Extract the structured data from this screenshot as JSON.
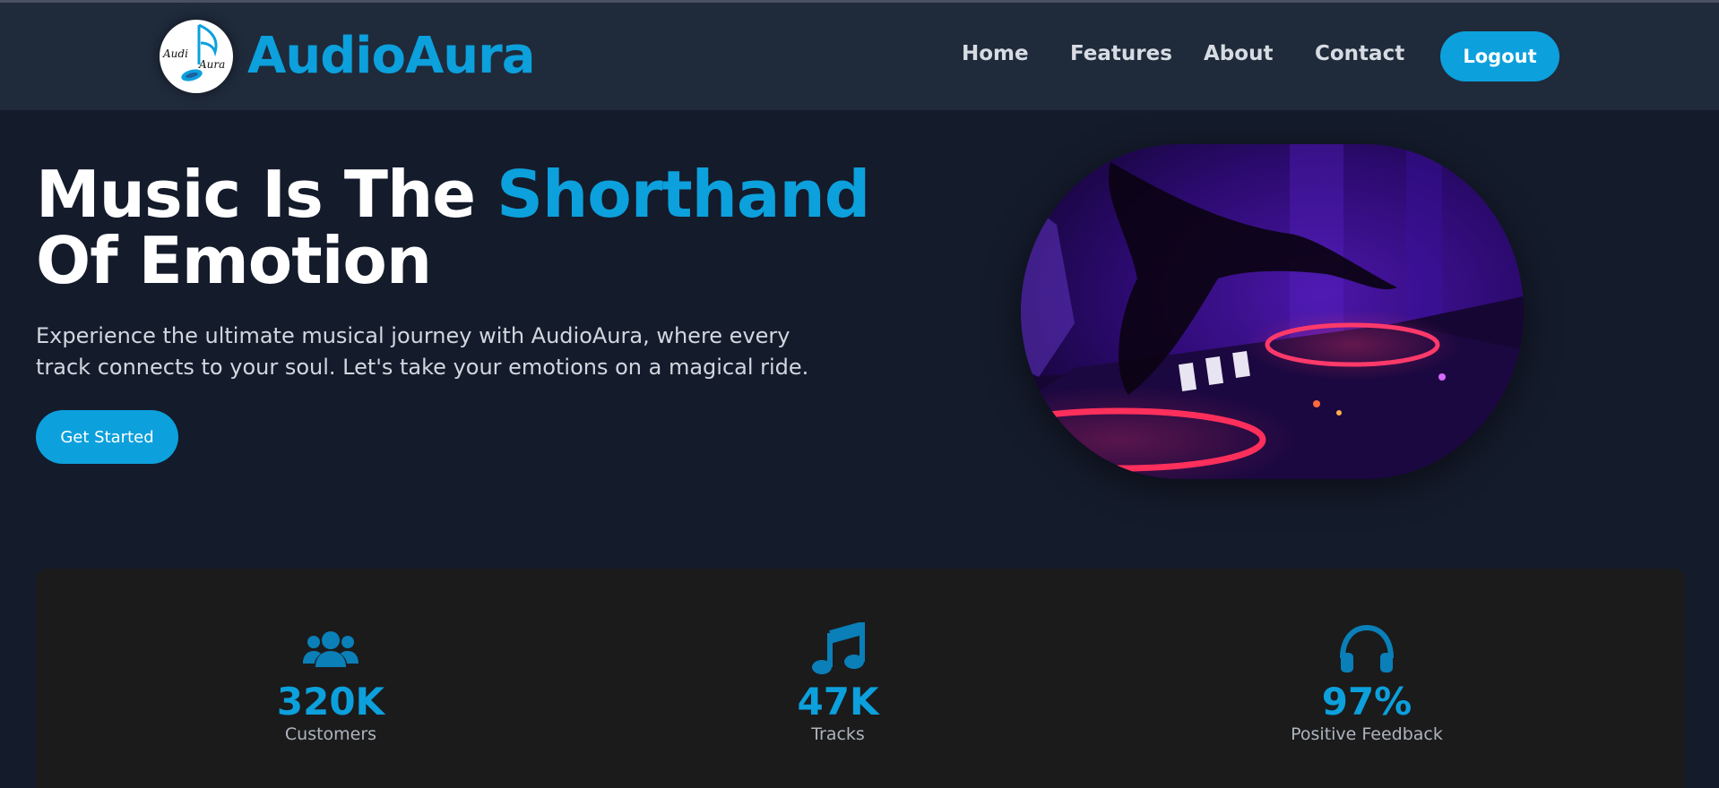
{
  "brand": {
    "name": "AudioAura",
    "logo_text_top": "Audi",
    "logo_text_bottom": "Aura",
    "accent_color": "#0ca0dc"
  },
  "nav": {
    "links": [
      "Home",
      "Features",
      "About",
      "Contact"
    ],
    "logout_label": "Logout"
  },
  "hero": {
    "title_part1": "Music Is The ",
    "title_accent": "Shorthand",
    "title_part2": "Of Emotion",
    "subtitle": "Experience the ultimate musical journey with AudioAura, where every track connects to your soul. Let's take your emotions on a magical ride.",
    "cta_label": "Get Started",
    "image_icon": "dj-mixer-photo"
  },
  "stats": [
    {
      "icon": "users-icon",
      "value": "320K",
      "label": "Customers"
    },
    {
      "icon": "music-note-icon",
      "value": "47K",
      "label": "Tracks"
    },
    {
      "icon": "headphones-icon",
      "value": "97%",
      "label": "Positive Feedback"
    }
  ]
}
